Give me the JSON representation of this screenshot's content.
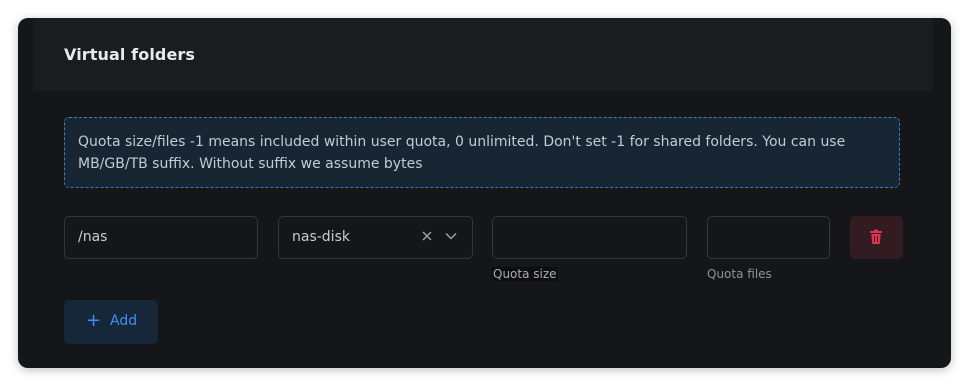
{
  "card": {
    "title": "Virtual folders"
  },
  "notice": {
    "text": "Quota size/files -1 means included within user quota, 0 unlimited. Don't set -1 for shared folders. You can use MB/GB/TB suffix. Without suffix we assume bytes"
  },
  "folder": {
    "path_value": "/nas",
    "storage_value": "nas-disk",
    "quota_size_value": "",
    "quota_files_value": "",
    "quota_size_hint": "Quota size",
    "quota_files_hint": "Quota files"
  },
  "actions": {
    "add_label": "Add"
  },
  "colors": {
    "accent": "#3d8ef0",
    "danger": "#e0334f",
    "background": "#151619"
  },
  "icons": {
    "clear": "x-icon",
    "dropdown": "chevron-down-icon",
    "delete": "trash-icon",
    "add": "plus-icon"
  }
}
